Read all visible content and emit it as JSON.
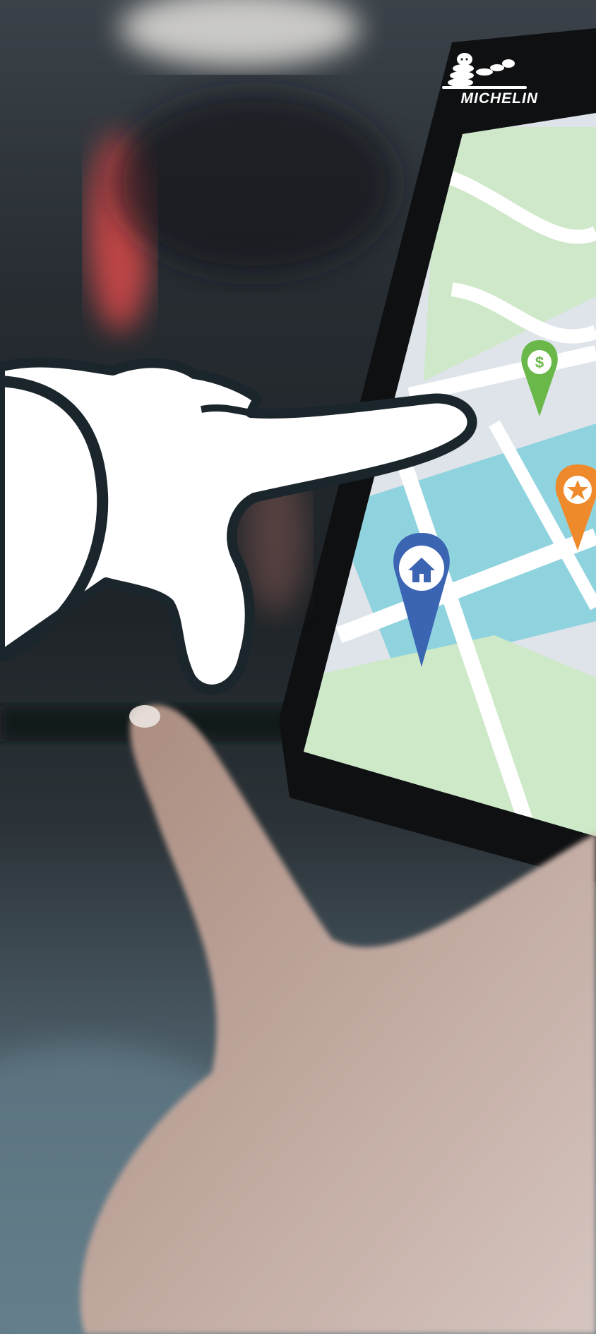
{
  "brand": {
    "name": "MICHELIN",
    "logo_icon": "michelin-man-logo-icon"
  },
  "scene": {
    "description_icon": "navigation-map-photo",
    "pointing_hand_icon": "cartoon-pointing-hand-icon",
    "markers": [
      {
        "icon": "dollar-map-pin-icon",
        "color": "#6ab84a"
      },
      {
        "icon": "star-map-pin-icon",
        "color": "#ef8a2c"
      },
      {
        "icon": "home-map-pin-icon",
        "color": "#3b64b2"
      }
    ]
  }
}
